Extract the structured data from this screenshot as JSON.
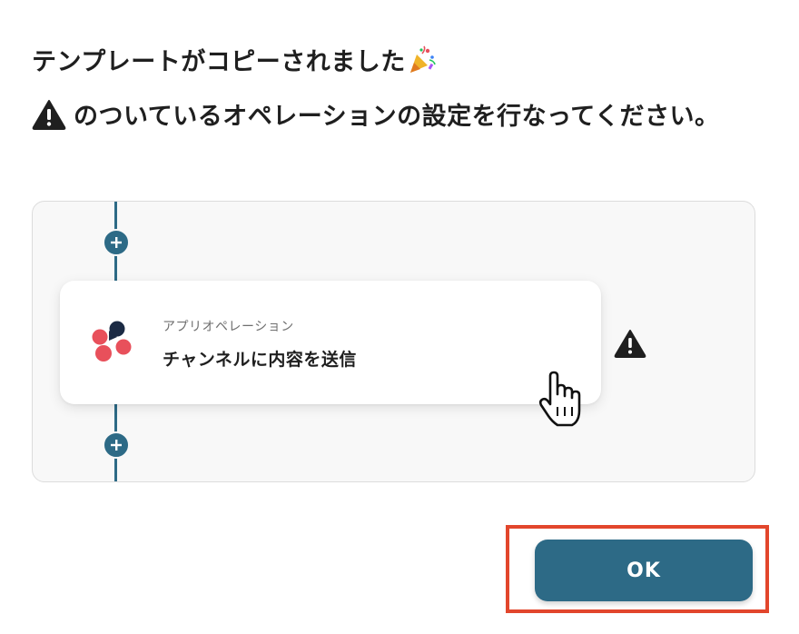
{
  "dialog": {
    "heading_line1": "テンプレートがコピーされました",
    "heading_line1_icon": "party-popper-icon",
    "heading_line2_icon": "warning-icon",
    "heading_line2": "のついているオペレーションの設定を行なってください。"
  },
  "flow": {
    "operation": {
      "type_label": "アプリオペレーション",
      "title": "チャンネルに内容を送信",
      "app_icon": "app-logo-icon",
      "status_icon": "warning-icon"
    },
    "add_step_icon": "plus-icon"
  },
  "actions": {
    "ok_label": "OK"
  },
  "colors": {
    "accent": "#2d6a86",
    "highlight": "#e2462c",
    "logo_red": "#e8505b",
    "logo_dark": "#1b2a44"
  }
}
